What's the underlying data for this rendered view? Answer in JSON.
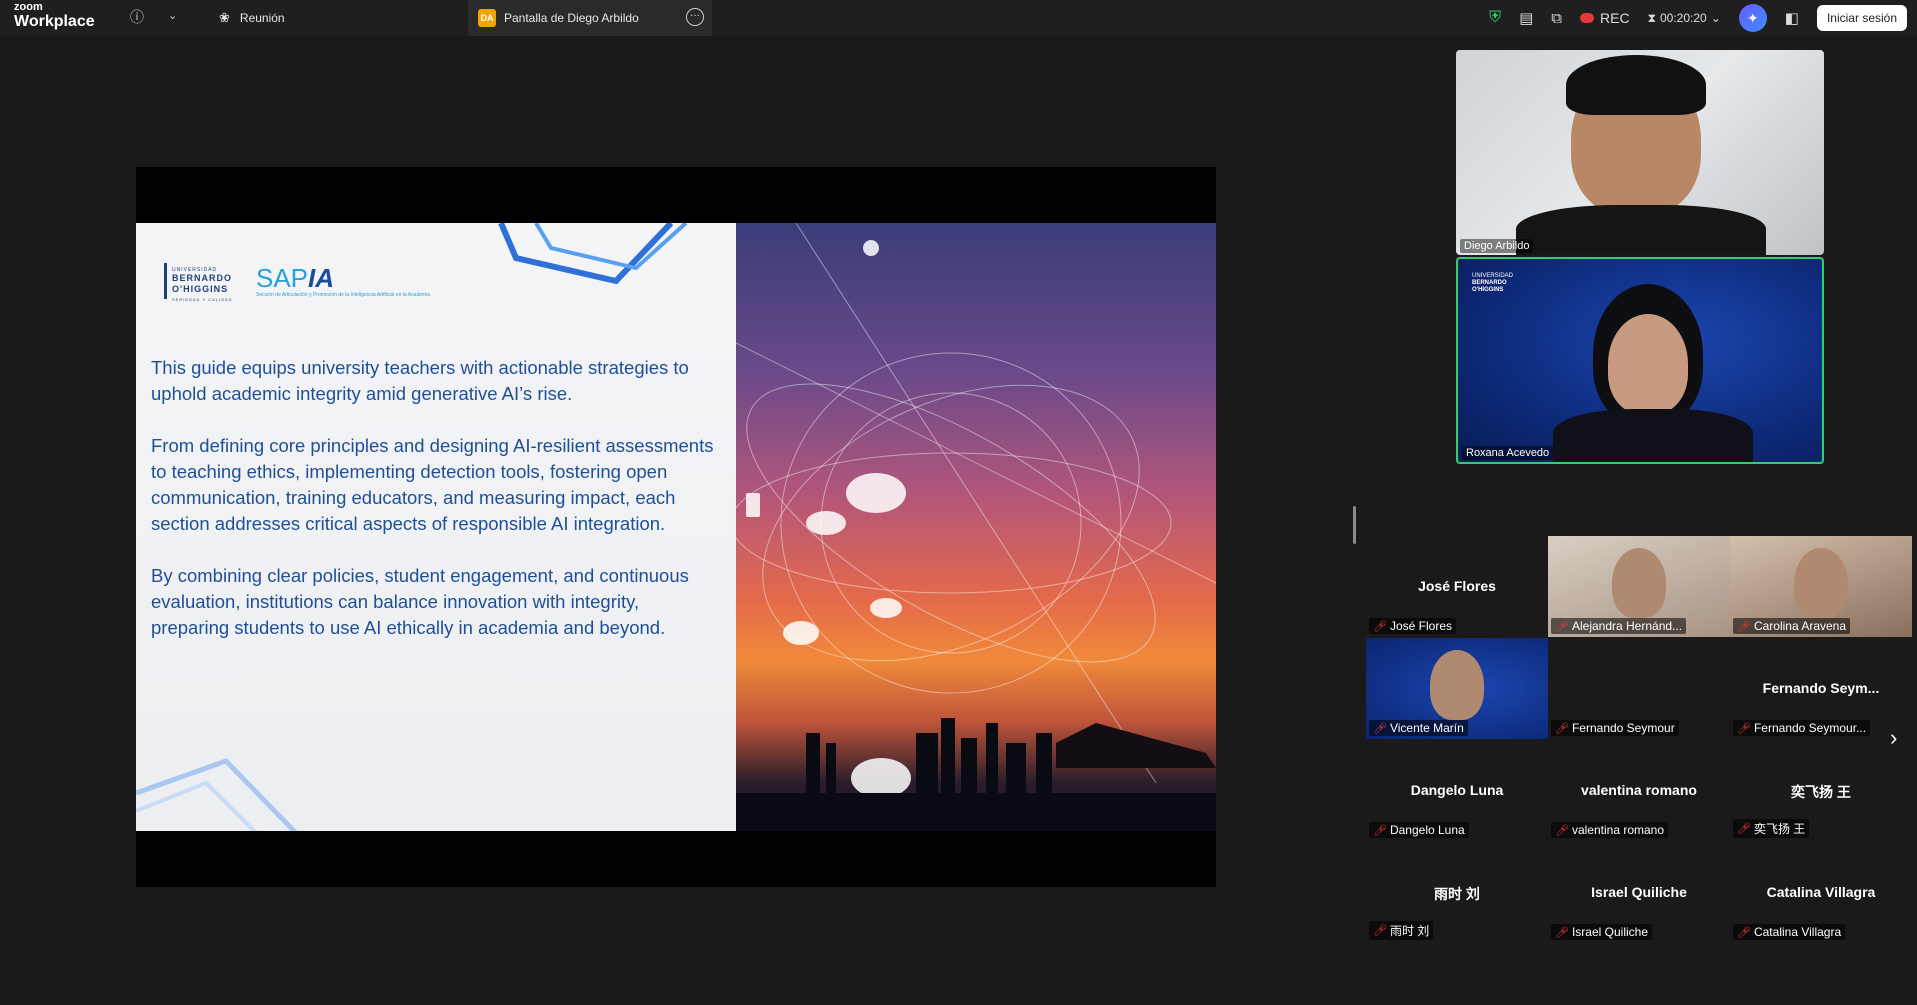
{
  "app": {
    "brand_small": "zoom",
    "brand_big": "Workplace"
  },
  "tabs": [
    {
      "label": "Reunión",
      "icon": "meeting-icon"
    },
    {
      "label": "Pantalla de Diego Arbildo",
      "icon": "screen-share-icon",
      "avatar": "DA"
    }
  ],
  "toolbar": {
    "rec_label": "REC",
    "timer": "00:20:20",
    "signin_label": "Iniciar sesión"
  },
  "slide": {
    "logo_ubo_top": "UNIVERSIDAD",
    "logo_ubo_name1": "BERNARDO",
    "logo_ubo_name2": "O'HIGGINS",
    "logo_ubo_tag": "SERIEDAD Y CALIDAD",
    "logo_sapia_a": "SAP",
    "logo_sapia_b": "IA",
    "logo_sapia_sub": "Sección de Articulación y Promoción de la Inteligencia Artificial en la Academia",
    "paragraphs": [
      "This guide equips university teachers with actionable strategies to uphold academic integrity amid generative AI’s rise.",
      "From defining core principles and designing AI-resilient assessments to teaching ethics, implementing detection tools, fostering open communication, training educators, and measuring impact, each section addresses critical aspects of responsible AI integration.",
      "By combining clear policies, student engagement, and continuous evaluation, institutions can balance innovation with integrity, preparing students to use AI ethically in academia and beyond."
    ]
  },
  "speakers": [
    {
      "name": "Diego Arbildo"
    },
    {
      "name": "Roxana Acevedo"
    }
  ],
  "participants": [
    {
      "big": "José Flores",
      "label": "José Flores",
      "video": false
    },
    {
      "big": "",
      "label": "Alejandra Hernánd...",
      "video": true
    },
    {
      "big": "",
      "label": "Carolina Aravena",
      "video": true
    },
    {
      "big": "",
      "label": "Vicente Marín",
      "video": true
    },
    {
      "big": "",
      "label": "Fernando Seymour",
      "video": false
    },
    {
      "big": "Fernando  Seym...",
      "label": "Fernando Seymour...",
      "video": false
    },
    {
      "big": "Dangelo Luna",
      "label": "Dangelo Luna",
      "video": false
    },
    {
      "big": "valentina romano",
      "label": "valentina romano",
      "video": false
    },
    {
      "big": "奕飞扬 王",
      "label": "奕飞扬 王",
      "video": false
    },
    {
      "big": "雨时 刘",
      "label": "雨时 刘",
      "video": false
    },
    {
      "big": "Israel Quiliche",
      "label": "Israel Quiliche",
      "video": false
    },
    {
      "big": "Catalina Villagra",
      "label": "Catalina Villagra",
      "video": false
    }
  ]
}
